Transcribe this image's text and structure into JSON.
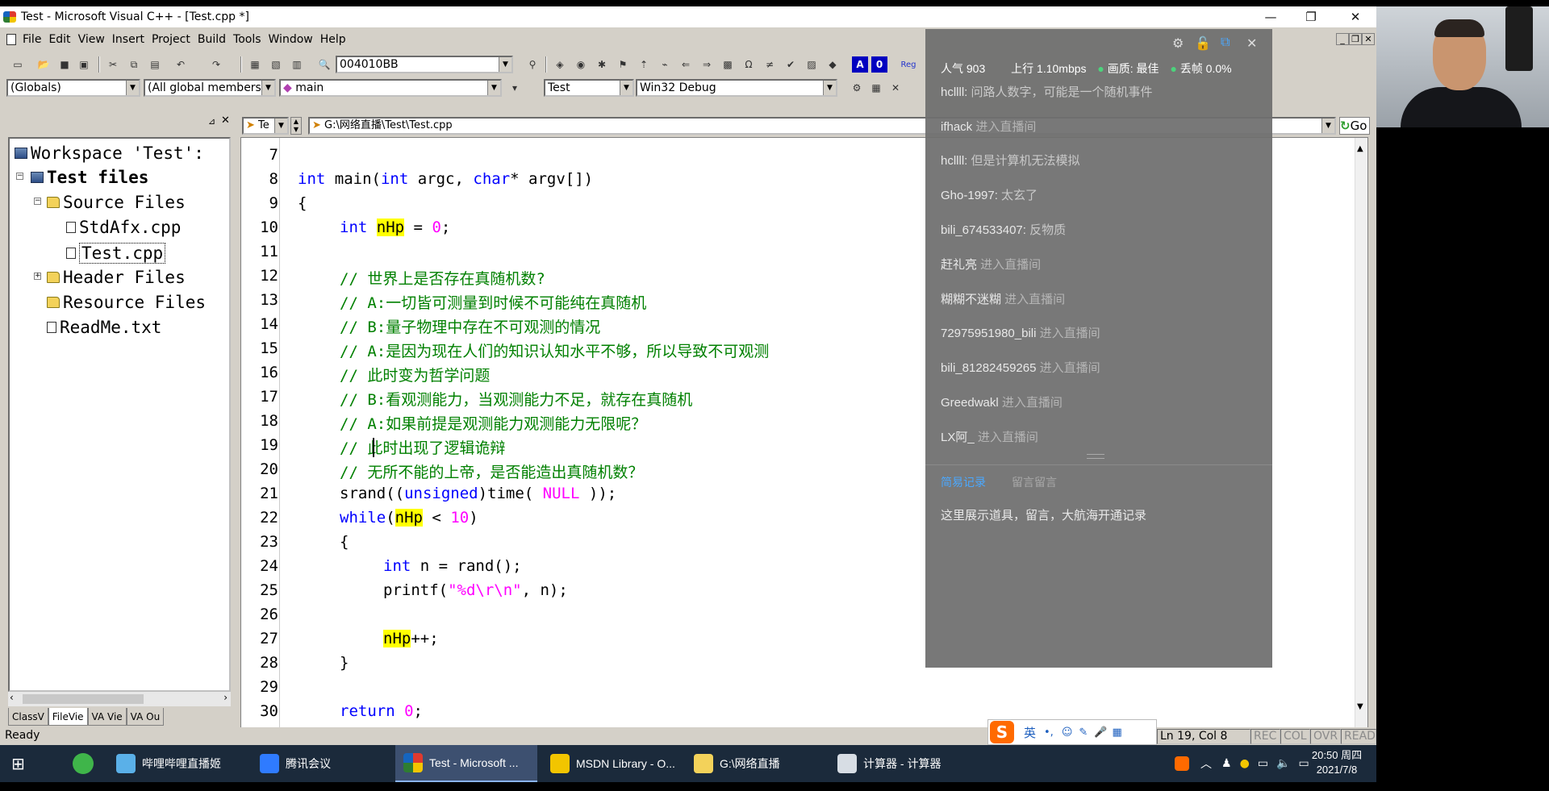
{
  "window": {
    "title": "Test - Microsoft Visual C++ - [Test.cpp *]",
    "controls": [
      "—",
      "❐",
      "✕"
    ]
  },
  "menu": [
    "File",
    "Edit",
    "View",
    "Insert",
    "Project",
    "Build",
    "Tools",
    "Window",
    "Help"
  ],
  "toolbar": {
    "address": "004010BB",
    "scope": "(Globals)",
    "members": "(All global members",
    "function": "main",
    "project": "Test",
    "config": "Win32 Debug"
  },
  "workspace": {
    "root": "Workspace 'Test':",
    "project": "Test files",
    "source_folder": "Source Files",
    "files": [
      "StdAfx.cpp",
      "Test.cpp"
    ],
    "header_folder": "Header Files",
    "resource_folder": "Resource Files",
    "readme": "ReadMe.txt",
    "tabs": [
      "ClassV",
      "FileVie",
      "VA Vie",
      "VA Ou"
    ]
  },
  "editor_head": {
    "tab": "Te",
    "path": "G:\\网络直播\\Test\\Test.cpp",
    "go": "Go"
  },
  "code": {
    "line_numbers": [
      "7",
      "8",
      "9",
      "10",
      "11",
      "12",
      "13",
      "14",
      "15",
      "16",
      "17",
      "18",
      "19",
      "20",
      "21",
      "22",
      "23",
      "24",
      "25",
      "26",
      "27",
      "28",
      "29",
      "30"
    ],
    "l8_kw1": "int",
    "l8_a": " main(",
    "l8_kw2": "int",
    "l8_b": " argc, ",
    "l8_kw3": "char",
    "l8_c": "* argv[])",
    "l9": "{",
    "l10_kw": "int",
    "l10_sp": " ",
    "l10_var": "nHp",
    "l10_eq": " = ",
    "l10_num": "0",
    "l10_end": ";",
    "l12": "// 世界上是否存在真随机数?",
    "l13": "// A:一切皆可测量到时候不可能纯在真随机",
    "l14": "// B:量子物理中存在不可观测的情况",
    "l15": "// A:是因为现在人们的知识认知水平不够，所以导致不可观测",
    "l16": "// 此时变为哲学问题",
    "l17": "// B:看观测能力，当观测能力不足，就存在真随机",
    "l18": "// A:如果前提是观测能力观测能力无限呢？",
    "l19": "// 此时出现了逻辑诡辩",
    "l20": "// 无所不能的上帝，是否能造出真随机数？",
    "l21_a": "srand((",
    "l21_kw": "unsigned",
    "l21_b": ")time( ",
    "l21_null": "NULL",
    "l21_c": " ));",
    "l22_kw": "while",
    "l22_a": "(",
    "l22_var": "nHp",
    "l22_b": " < ",
    "l22_num": "10",
    "l22_c": ")",
    "l23": "{",
    "l24_kw": "int",
    "l24_a": " n = rand();",
    "l25_a": "printf(",
    "l25_str": "\"%d\\r\\n\"",
    "l25_b": ", n);",
    "l27_var": "nHp",
    "l27_a": "++;",
    "l28": "}",
    "l30_kw": "return",
    "l30_sp": " ",
    "l30_num": "0",
    "l30_end": ";"
  },
  "overlay": {
    "stats_popularity": "人气 903",
    "stats_upload": "上行 1.10mbps",
    "stats_quality": "画质: 最佳",
    "stats_drop": "丢帧 0.0%",
    "messages": [
      {
        "user": "hcllll:",
        "text": " 问路人数字，可能是一个随机事件",
        "kind": "chat"
      },
      {
        "user": "ifhack",
        "text": " 进入直播间",
        "kind": "enter"
      },
      {
        "user": "hcllll:",
        "text": " 但是计算机无法模拟",
        "kind": "chat"
      },
      {
        "user": "Gho-1997:",
        "text": " 太玄了",
        "kind": "chat"
      },
      {
        "user": "bili_674533407:",
        "text": " 反物质",
        "kind": "chat"
      },
      {
        "user": "赶礼亮",
        "text": " 进入直播间",
        "kind": "enter"
      },
      {
        "user": "糊糊不迷糊",
        "text": " 进入直播间",
        "kind": "enter"
      },
      {
        "user": "72975951980_bili",
        "text": " 进入直播间",
        "kind": "enter"
      },
      {
        "user": "bili_81282459265",
        "text": " 进入直播间",
        "kind": "enter"
      },
      {
        "user": "Greedwakl",
        "text": " 进入直播间",
        "kind": "enter"
      },
      {
        "user": "LX阿_",
        "text": " 进入直播间",
        "kind": "enter"
      }
    ],
    "tab_gifts": "简易记录",
    "tab_comments": "留言留言",
    "footer_text": "这里展示道具，留言，大航海开通记录"
  },
  "status": {
    "ready": "Ready",
    "position": "Ln 19, Col 8",
    "rec": "REC",
    "col": "COL",
    "ovr": "OVR",
    "read": "READ"
  },
  "ime": {
    "lang": "英"
  },
  "taskbar": {
    "items": [
      "哔哩哔哩直播姬",
      "腾讯会议",
      "Test - Microsoft ...",
      "MSDN Library - O...",
      "G:\\网络直播",
      "计算器 - 计算器"
    ],
    "time": "20:50 周四",
    "date": "2021/7/8"
  },
  "colors": {
    "keyword": "#0000ff",
    "number": "#ff00ff",
    "comment": "#008000",
    "highlight": "#ffff00"
  }
}
